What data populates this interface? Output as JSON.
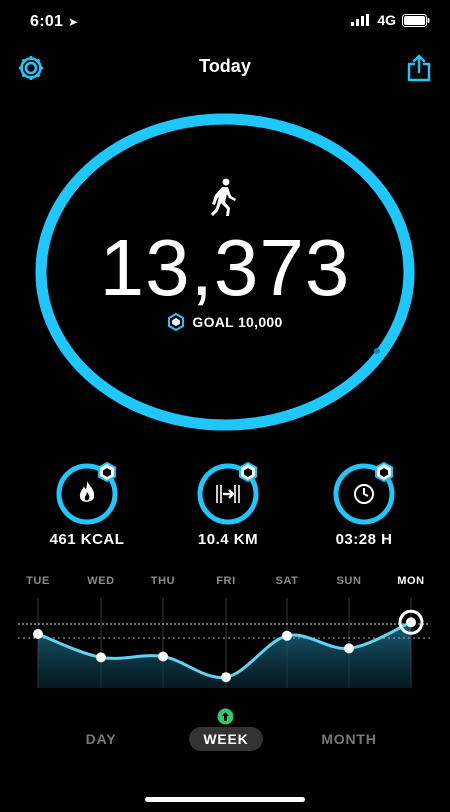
{
  "status_bar": {
    "time": "6:01",
    "network": "4G"
  },
  "header": {
    "title": "Today"
  },
  "steps": {
    "value": "13,373",
    "goal_text": "GOAL 10,000",
    "progress": 1.0
  },
  "stats": [
    {
      "label": "461 KCAL",
      "icon": "flame-icon"
    },
    {
      "label": "10.4 KM",
      "icon": "distance-icon"
    },
    {
      "label": "03:28 H",
      "icon": "clock-icon"
    }
  ],
  "chart_data": {
    "type": "area",
    "categories": [
      "TUE",
      "WED",
      "THU",
      "FRI",
      "SAT",
      "SUN",
      "MON"
    ],
    "values": [
      0.6,
      0.34,
      0.35,
      0.12,
      0.58,
      0.44,
      0.73
    ],
    "highlighted": "MON",
    "reference_lines": 2
  },
  "tabs": {
    "day": "DAY",
    "week": "WEEK",
    "month": "MONTH",
    "active": "week"
  },
  "colors": {
    "accent": "#1ec8ff",
    "ring": "#12b5f5",
    "background": "#000000",
    "badge_green": "#2ecc71"
  }
}
